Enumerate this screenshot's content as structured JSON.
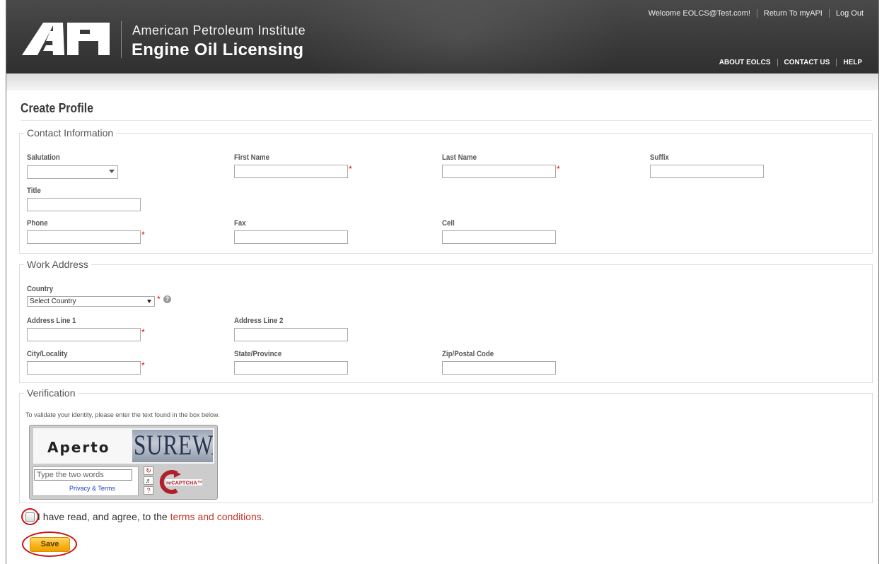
{
  "header": {
    "org_name": "American Petroleum Institute",
    "app_name": "Engine Oil Licensing",
    "logo_text": "API",
    "top_links": [
      "Welcome EOLCS@Test.com!",
      "Return To myAPI",
      "Log Out"
    ],
    "nav": [
      "ABOUT EOLCS",
      "CONTACT US",
      "HELP"
    ]
  },
  "page": {
    "title": "Create Profile"
  },
  "contact": {
    "legend": "Contact Information",
    "salutation_label": "Salutation",
    "salutation_value": "",
    "first_name_label": "First Name",
    "last_name_label": "Last Name",
    "suffix_label": "Suffix",
    "title_label": "Title",
    "phone_label": "Phone",
    "fax_label": "Fax",
    "cell_label": "Cell"
  },
  "address": {
    "legend": "Work Address",
    "country_label": "Country",
    "country_value": "Select Country",
    "line1_label": "Address Line 1",
    "line2_label": "Address Line 2",
    "city_label": "City/Locality",
    "state_label": "State/Province",
    "zip_label": "Zip/Postal Code"
  },
  "verification": {
    "legend": "Verification",
    "instructions": "To validate your identity, please enter the text found in the box below.",
    "captcha_word1": "Aperto",
    "captcha_word2": "SUREWAY",
    "captcha_placeholder": "Type the two words",
    "privacy_link": "Privacy & Terms"
  },
  "terms": {
    "text": "I have read, and agree, to the ",
    "link": "terms and conditions."
  },
  "actions": {
    "save_label": "Save"
  },
  "required_marker": "*",
  "colors": {
    "accent_red": "#cc1111",
    "save_button": "#f7b51b",
    "header_bg": "#3a3a3a",
    "link": "#c0392b"
  }
}
